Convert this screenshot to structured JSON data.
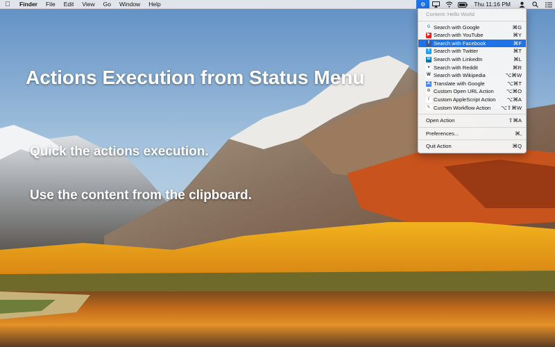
{
  "menubar": {
    "apple": "",
    "app_name": "Finder",
    "menus": [
      "File",
      "Edit",
      "View",
      "Go",
      "Window",
      "Help"
    ],
    "status_icons": [
      "gear-icon",
      "airplay-icon",
      "wifi-icon",
      "battery-icon"
    ],
    "clock": "Thu 11:16 PM",
    "user_icon": "user-icon",
    "search_icon": "spotlight-icon",
    "list_icon": "notification-center-icon",
    "accent": "#1e73e8"
  },
  "overlay": {
    "headline": "Actions Execution from Status Menu",
    "feature_1": "Quick the actions execution.",
    "feature_2": "Use the content from the clipboard."
  },
  "dropdown": {
    "content_label": "Content: Hello World",
    "actions": [
      {
        "label": "Search with Google",
        "shortcut": "⌘G",
        "icon": "google-icon",
        "icon_color": "#ffffff",
        "icon_text": "G",
        "icon_fg": "#4285f4"
      },
      {
        "label": "Search with YouTube",
        "shortcut": "⌘Y",
        "icon": "youtube-icon",
        "icon_color": "#e62117",
        "icon_text": "▶",
        "icon_fg": "#ffffff"
      },
      {
        "label": "Search with Facebook",
        "shortcut": "⌘F",
        "icon": "facebook-icon",
        "icon_color": "#3b5998",
        "icon_text": "f",
        "icon_fg": "#ffffff"
      },
      {
        "label": "Search with Twitter",
        "shortcut": "⌘T",
        "icon": "twitter-icon",
        "icon_color": "#1da1f2",
        "icon_text": "t",
        "icon_fg": "#ffffff"
      },
      {
        "label": "Search with LinkedIn",
        "shortcut": "⌘L",
        "icon": "linkedin-icon",
        "icon_color": "#0077b5",
        "icon_text": "in",
        "icon_fg": "#ffffff"
      },
      {
        "label": "Search with Reddit",
        "shortcut": "⌘R",
        "icon": "reddit-icon",
        "icon_color": "#ffffff",
        "icon_text": "●",
        "icon_fg": "#555555"
      },
      {
        "label": "Search with Wikipedia",
        "shortcut": "⌥⌘W",
        "icon": "wikipedia-icon",
        "icon_color": "#ffffff",
        "icon_text": "W",
        "icon_fg": "#222222"
      },
      {
        "label": "Translate with Google",
        "shortcut": "⌥⌘T",
        "icon": "google-translate-icon",
        "icon_color": "#4285f4",
        "icon_text": "文",
        "icon_fg": "#ffffff"
      },
      {
        "label": "Custom Open URL Action",
        "shortcut": "⌥⌘O",
        "icon": "gear-icon",
        "icon_color": "#ffffff",
        "icon_text": "⚙",
        "icon_fg": "#333333"
      },
      {
        "label": "Custom AppleScript Action",
        "shortcut": "⌥⌘A",
        "icon": "applescript-icon",
        "icon_color": "#ffffff",
        "icon_text": "/",
        "icon_fg": "#666666"
      },
      {
        "label": "Custom Workflow Action",
        "shortcut": "⌥⇧⌘W",
        "icon": "automator-icon",
        "icon_color": "#ffffff",
        "icon_text": "✎",
        "icon_fg": "#555555"
      }
    ],
    "open_action": {
      "label": "Open Action",
      "shortcut": "⇧⌘A"
    },
    "preferences": {
      "label": "Preferences...",
      "shortcut": "⌘,"
    },
    "quit": {
      "label": "Quit Action",
      "shortcut": "⌘Q"
    },
    "highlighted_index": 2,
    "highlight_color": "#1e73e8"
  }
}
